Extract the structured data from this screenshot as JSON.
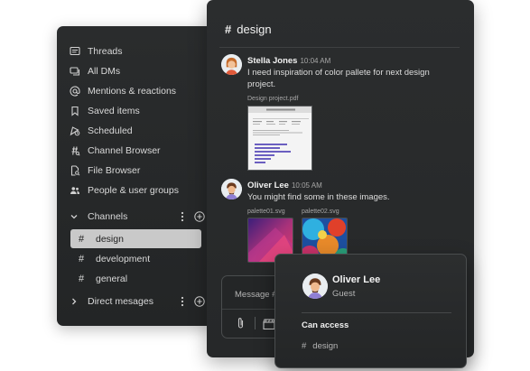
{
  "sidebar": {
    "nav_items": [
      {
        "label": "Threads",
        "icon": "threads-icon"
      },
      {
        "label": "All DMs",
        "icon": "dms-icon"
      },
      {
        "label": "Mentions & reactions",
        "icon": "at-icon"
      },
      {
        "label": "Saved items",
        "icon": "bookmark-icon"
      },
      {
        "label": "Scheduled",
        "icon": "scheduled-icon"
      },
      {
        "label": "Channel Browser",
        "icon": "channel-browser-icon"
      },
      {
        "label": "File Browser",
        "icon": "file-browser-icon"
      },
      {
        "label": "People & user groups",
        "icon": "people-icon"
      }
    ],
    "channels_section": {
      "label": "Channels",
      "items": [
        {
          "label": "design",
          "active": true
        },
        {
          "label": "development",
          "active": false
        },
        {
          "label": "general",
          "active": false
        }
      ]
    },
    "dm_section": {
      "label": "Direct mesages"
    }
  },
  "main": {
    "channel_name": "design",
    "messages": [
      {
        "author": "Stella Jones",
        "time": "10:04 AM",
        "text": "I need inspiration of color pallete for next design project.",
        "attachment_label": "Design project.pdf"
      },
      {
        "author": "Oliver Lee",
        "time": "10:05 AM",
        "text": "You might find some in these images.",
        "attachments": [
          "palette01.svg",
          "palette02.svg"
        ]
      }
    ],
    "composer": {
      "placeholder": "Message #"
    }
  },
  "popover": {
    "name": "Oliver Lee",
    "role": "Guest",
    "access_heading": "Can access",
    "channel": "design"
  },
  "colors": {
    "panel_bg": "#2a2c2d",
    "active_channel_bg": "#c9c9c9",
    "text_primary": "#f2f2f2",
    "text_secondary": "#a6a6a6"
  }
}
